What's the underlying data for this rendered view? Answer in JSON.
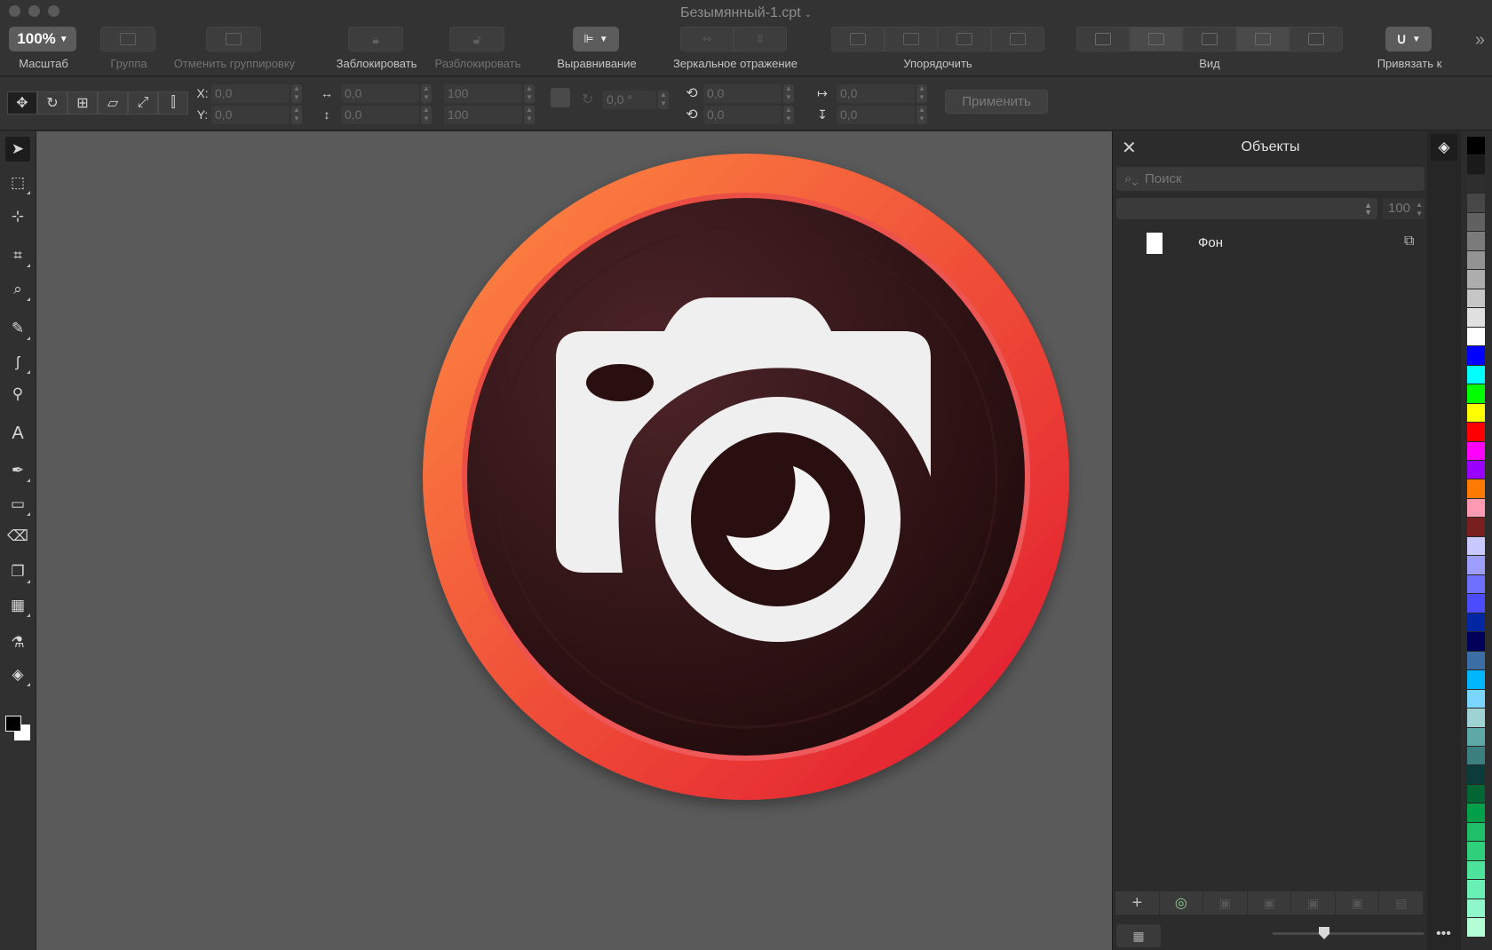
{
  "window": {
    "title": "Безымянный-1.cpt"
  },
  "toolbar": {
    "zoom": {
      "value": "100%",
      "label": "Масштаб"
    },
    "group_label": "Группа",
    "ungroup_label": "Отменить группировку",
    "lock_label": "Заблокировать",
    "unlock_label": "Разблокировать",
    "align_label": "Выравнивание",
    "mirror_label": "Зеркальное отражение",
    "arrange_label": "Упорядочить",
    "view_label": "Вид",
    "snap_label": "Привязать к"
  },
  "properties": {
    "x_label": "X:",
    "x_value": "0,0",
    "y_label": "Y:",
    "y_value": "0,0",
    "width_value": "0,0",
    "height_value": "0,0",
    "scale_w": "100",
    "scale_h": "100",
    "angle": "0,0 °",
    "rot_x": "0,0",
    "rot_y": "0,0",
    "skew_h": "0,0",
    "skew_v": "0,0",
    "apply_label": "Применить"
  },
  "objects_panel": {
    "title": "Объекты",
    "search_placeholder": "Поиск",
    "opacity": "100",
    "layers": [
      {
        "name": "Фон"
      }
    ]
  },
  "canvas": {
    "logo": {
      "ring_colors": [
        "#ff8c42",
        "#e0152f"
      ],
      "disc_color": "#2a0f10",
      "glyph_color": "#f0f0f0",
      "icon": "camera-icon"
    }
  },
  "palette": [
    "#000000",
    "#1a1a1a",
    "#2e2e2e",
    "#474747",
    "#616161",
    "#7a7a7a",
    "#939393",
    "#adadad",
    "#c6c6c6",
    "#e0e0e0",
    "#ffffff",
    "#0000ff",
    "#00ffff",
    "#00ff00",
    "#ffff00",
    "#ff0000",
    "#ff00ff",
    "#9900ff",
    "#ff7a00",
    "#ff9ab3",
    "#7a1f1f",
    "#c9c9ff",
    "#9e9eff",
    "#7070ff",
    "#4c4cff",
    "#0026a3",
    "#00005a",
    "#3a6ea5",
    "#00b7ff",
    "#7ad6ff",
    "#9fd3d3",
    "#5fa8a8",
    "#3c7f7f",
    "#0b3b3b",
    "#006633",
    "#00a04a",
    "#1fbf6a",
    "#2fd07c",
    "#4de39a",
    "#6af0b4",
    "#8ff7c9",
    "#b5ffd6"
  ]
}
